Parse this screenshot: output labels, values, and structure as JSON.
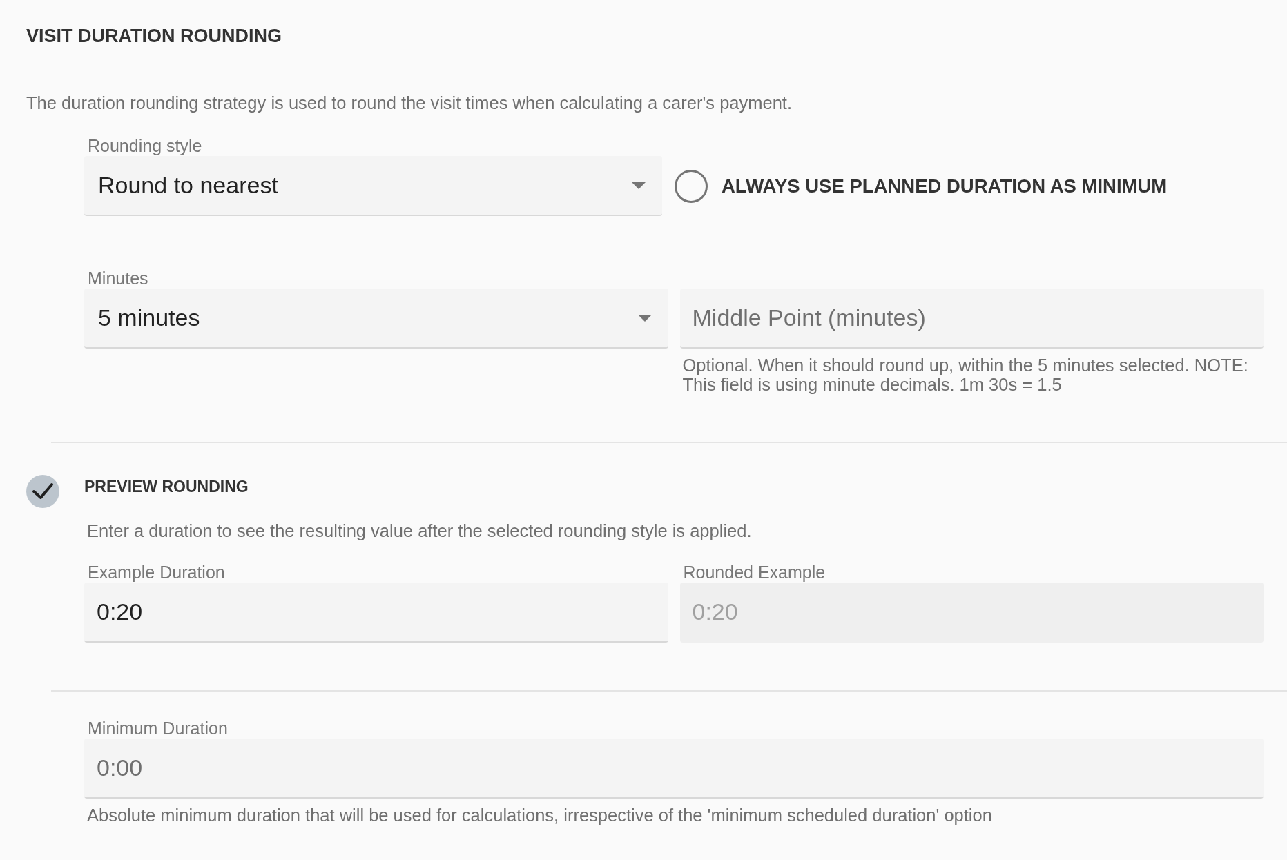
{
  "section": {
    "title": "VISIT DURATION ROUNDING",
    "description": "The duration rounding strategy is used to round the visit times when calculating a carer's payment."
  },
  "rounding_style": {
    "label": "Rounding style",
    "value": "Round to nearest"
  },
  "planned_duration_minimum": {
    "label": "ALWAYS USE PLANNED DURATION AS MINIMUM",
    "checked": false
  },
  "minutes": {
    "label": "Minutes",
    "value": "5 minutes"
  },
  "middle_point": {
    "placeholder": "Middle Point (minutes)",
    "disabled": false,
    "help": "Optional. When it should round up, within the 5 minutes selected. NOTE: This field is using minute decimals. 1m 30s = 1.5"
  },
  "preview": {
    "title": "PREVIEW ROUNDING",
    "checked": true,
    "description": "Enter a duration to see the resulting value after the selected rounding style is applied.",
    "example_duration": {
      "label": "Example Duration",
      "value": "0:20",
      "disabled": false
    },
    "rounded_example": {
      "label": "Rounded Example",
      "value": "0:20",
      "disabled": true
    }
  },
  "minimum_duration": {
    "label": "Minimum Duration",
    "placeholder": "0:00",
    "disabled": false,
    "help": "Absolute minimum duration that will be used for calculations, irrespective of the 'minimum scheduled duration' option"
  }
}
